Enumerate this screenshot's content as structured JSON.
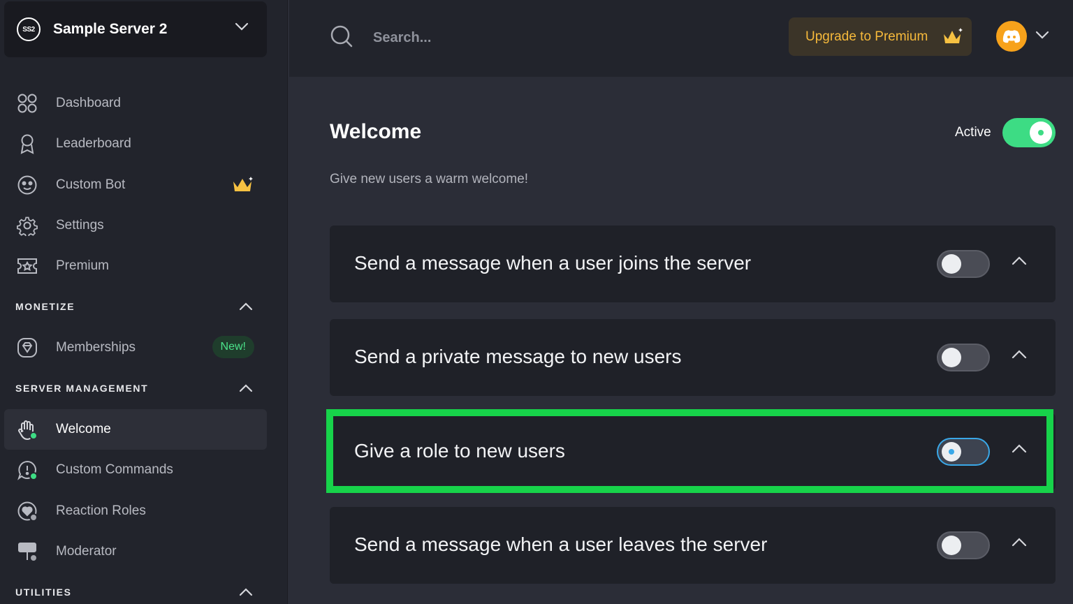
{
  "sidebar": {
    "server": {
      "initials": "SS2",
      "name": "Sample Server 2"
    },
    "items": [
      {
        "label": "Dashboard"
      },
      {
        "label": "Leaderboard"
      },
      {
        "label": "Custom Bot"
      },
      {
        "label": "Settings"
      },
      {
        "label": "Premium"
      }
    ],
    "sections": {
      "monetize": {
        "title": "MONETIZE",
        "items": [
          {
            "label": "Memberships",
            "badge": "New!"
          }
        ]
      },
      "server_management": {
        "title": "SERVER MANAGEMENT",
        "items": [
          {
            "label": "Welcome",
            "active": true
          },
          {
            "label": "Custom Commands"
          },
          {
            "label": "Reaction Roles"
          },
          {
            "label": "Moderator"
          }
        ]
      },
      "utilities": {
        "title": "UTILITIES"
      }
    }
  },
  "topbar": {
    "search_placeholder": "Search...",
    "upgrade_label": "Upgrade to Premium"
  },
  "main": {
    "title": "Welcome",
    "status_label": "Active",
    "status_on": true,
    "subtitle": "Give new users a warm welcome!",
    "cards": [
      {
        "label": "Send a message when a user joins the server",
        "enabled": false
      },
      {
        "label": "Send a private message to new users",
        "enabled": false
      },
      {
        "label": "Give a role to new users",
        "enabled": false,
        "highlighted": true
      },
      {
        "label": "Send a message when a user leaves the server",
        "enabled": false
      }
    ]
  },
  "colors": {
    "accent_green": "#3ddc84",
    "premium_gold": "#f6b93b",
    "avatar_orange": "#f7a21b",
    "highlight_green": "#17d34a"
  }
}
